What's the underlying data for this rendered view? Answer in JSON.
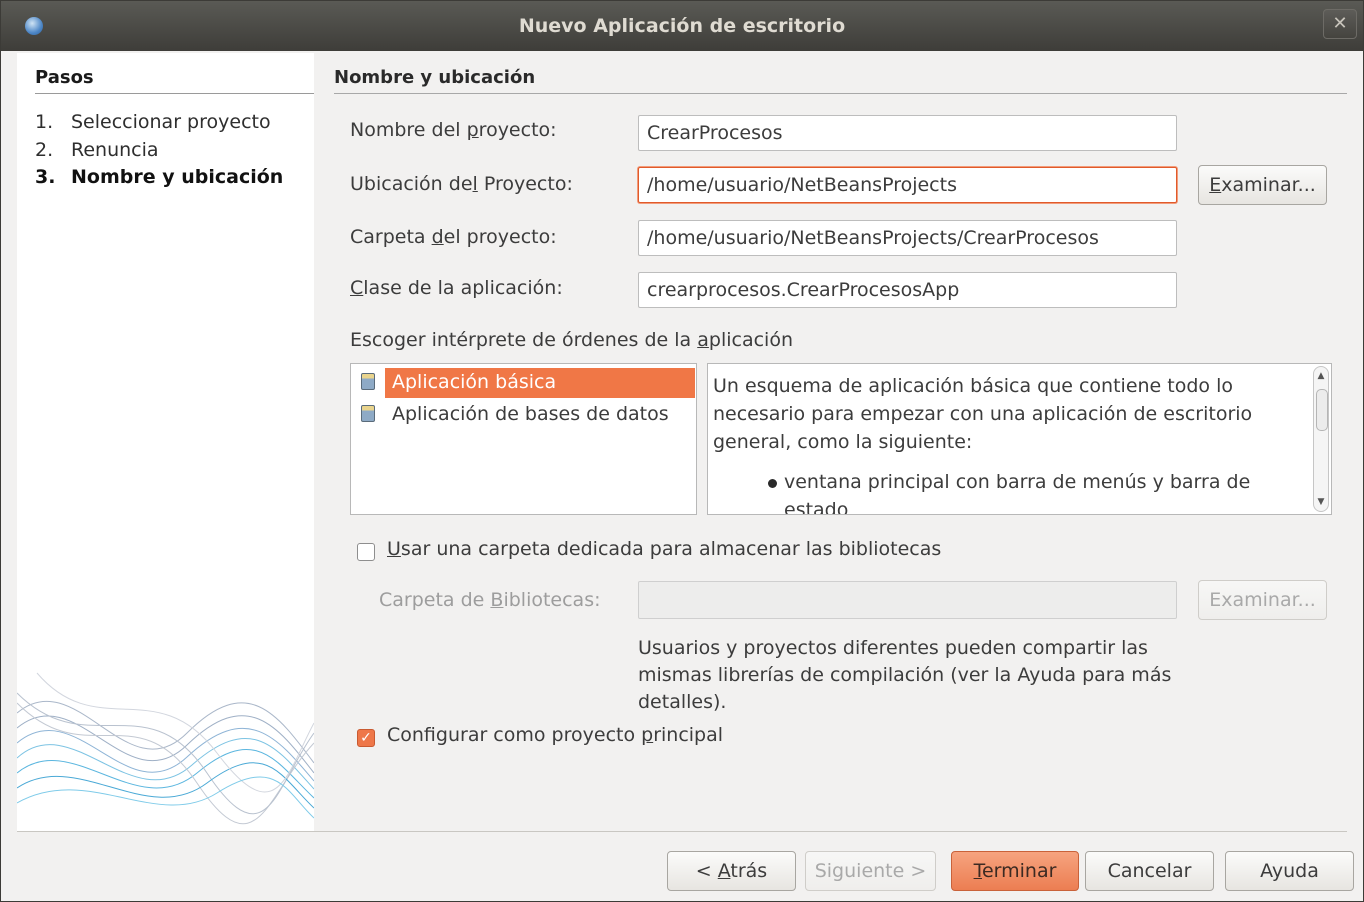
{
  "window": {
    "title": "Nuevo  Aplicación de escritorio",
    "close_glyph": "✕"
  },
  "steps": {
    "heading": "Pasos",
    "items": [
      {
        "num": "1.",
        "label": "Seleccionar proyecto"
      },
      {
        "num": "2.",
        "label": "Renuncia"
      },
      {
        "num": "3.",
        "label": "Nombre y ubicación"
      }
    ]
  },
  "section": {
    "heading": "Nombre y ubicación"
  },
  "form": {
    "project_name": {
      "label_a": "Nombre del ",
      "label_u": "p",
      "label_b": "royecto:",
      "value": "CrearProcesos"
    },
    "project_location": {
      "label_a": "Ubicación de",
      "label_u": "l",
      "label_b": " Proyecto:",
      "value": "/home/usuario/NetBeansProjects"
    },
    "project_folder": {
      "label_a": "Carpeta ",
      "label_u": "d",
      "label_b": "el proyecto:",
      "value": "/home/usuario/NetBeansProjects/CrearProcesos"
    },
    "app_class": {
      "label_a": "",
      "label_u": "C",
      "label_b": "lase de la aplicación:",
      "value": "crearprocesos.CrearProcesosApp"
    },
    "browse_button": {
      "label_u": "E",
      "label_b": "xaminar..."
    }
  },
  "shell": {
    "label_a": "Escoger intérprete de órdenes de la ",
    "label_u": "a",
    "label_b": "plicación",
    "options": [
      "Aplicación básica",
      "Aplicación de bases de datos"
    ],
    "description": "Un esquema de aplicación básica que contiene todo lo necesario para empezar con una aplicación de escritorio general, como la siguiente:",
    "bullet": "ventana principal con barra de menús y barra de estado"
  },
  "libraries": {
    "checkbox_u": "U",
    "checkbox_b": "sar una carpeta dedicada para almacenar las bibliotecas",
    "checked": false,
    "folder_label_a": "Carpeta de ",
    "folder_label_u": "B",
    "folder_label_b": "ibliotecas:",
    "folder_value": "",
    "browse_label": "Examinar...",
    "note": "Usuarios y proyectos diferentes pueden compartir las mismas librerías de compilación (ver la Ayuda para más detalles)."
  },
  "main_project": {
    "label_a": "Configurar como proyecto ",
    "label_u": "p",
    "label_b": "rincipal",
    "checked": true
  },
  "footer": {
    "back_prefix": "< ",
    "back_u": "A",
    "back_b": "trás",
    "next": "Siguiente >",
    "finish_u": "T",
    "finish_b": "erminar",
    "cancel": "Cancelar",
    "help": "Ayuda"
  },
  "colors": {
    "accent": "#f07746",
    "titlebar": "#3e3d39",
    "background": "#f2f1f0"
  },
  "icons": {
    "app": "netbeans-app-icon",
    "list": "form-template-icon"
  }
}
